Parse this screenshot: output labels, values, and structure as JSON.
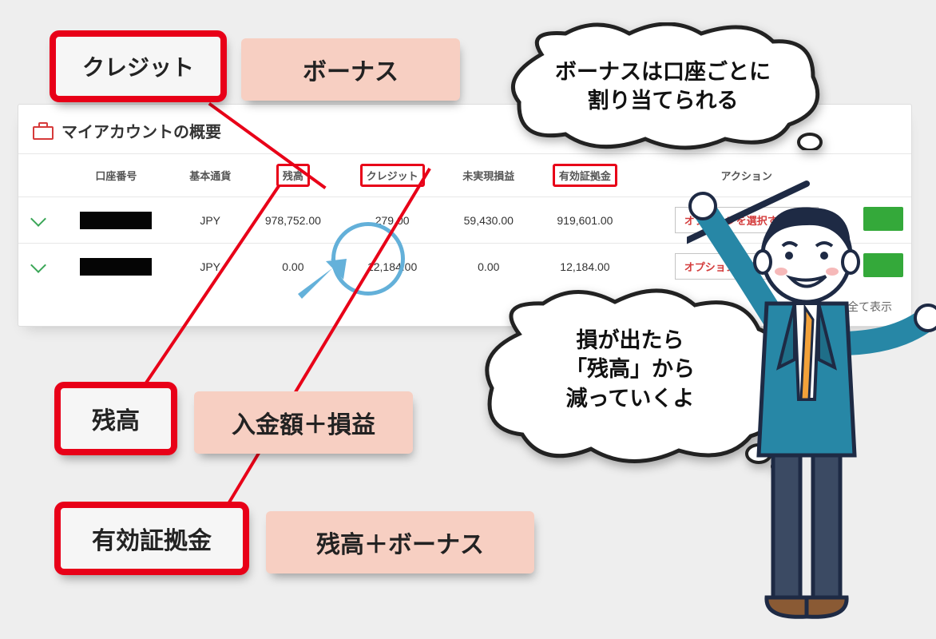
{
  "callouts": {
    "credit": "クレジット",
    "bonus": "ボーナス",
    "balance": "残高",
    "balance_desc": "入金額＋損益",
    "margin": "有効証拠金",
    "margin_desc": "残高＋ボーナス"
  },
  "panel": {
    "title": "マイアカウントの概要",
    "footer": "全て表示",
    "columns": {
      "account": "口座番号",
      "base_currency": "基本通貨",
      "balance": "残高",
      "credit": "クレジット",
      "unrealized": "未実現損益",
      "margin": "有効証拠金",
      "action": "アクション"
    },
    "highlighted_columns": [
      "balance",
      "credit",
      "margin"
    ],
    "options_button": "オプションを選択する",
    "rows": [
      {
        "currency": "JPY",
        "balance": "978,752.00",
        "credit": "279.00",
        "unrealized": "59,430.00",
        "margin": "919,601.00"
      },
      {
        "currency": "JPY",
        "balance": "0.00",
        "credit": "12,184.00",
        "unrealized": "0.00",
        "margin": "12,184.00"
      }
    ]
  },
  "bubbles": {
    "top": "ボーナスは口座ごとに\n割り当てられる",
    "bottom": "損が出たら\n「残高」から\n減っていくよ"
  }
}
